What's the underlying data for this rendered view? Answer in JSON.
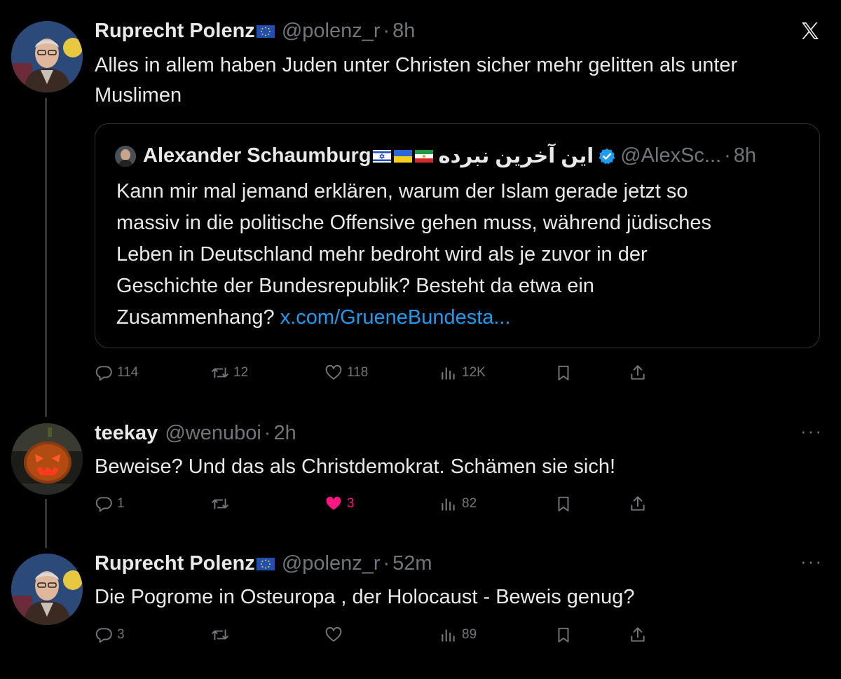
{
  "tweet1": {
    "author": "Ruprecht Polenz",
    "handle": "@polenz_r",
    "time": "8h",
    "text_line1": "Alles in allem haben Juden unter Christen sicher mehr gelitten als unter",
    "text_line2": "Muslimen",
    "quote": {
      "author": "Alexander Schaumburg",
      "author_rtl": "این آخرین نبرده",
      "handle": "@AlexSc...",
      "time": "8h",
      "lines": [
        "Kann mir mal jemand erklären, warum der Islam gerade jetzt so",
        "massiv in die politische Offensive gehen muss, während jüdisches",
        "Leben in Deutschland mehr bedroht wird als je zuvor in der",
        "Geschichte der Bundesrepublik? Besteht da etwa ein",
        "Zusammenhang?"
      ],
      "link": "x.com/GrueneBundesta..."
    },
    "stats": {
      "replies": "114",
      "retweets": "12",
      "likes": "118",
      "views": "12K"
    }
  },
  "tweet2": {
    "author": "teekay",
    "handle": "@wenuboi",
    "time": "2h",
    "text": "Beweise? Und das als Christdemokrat. Schämen sie sich!",
    "stats": {
      "replies": "1",
      "retweets": "",
      "likes": "3",
      "views": "82"
    }
  },
  "tweet3": {
    "author": "Ruprecht Polenz",
    "handle": "@polenz_r",
    "time": "52m",
    "text": "Die Pogrome in Osteuropa , der Holocaust - Beweis genug?",
    "stats": {
      "replies": "3",
      "retweets": "",
      "likes": "",
      "views": "89"
    }
  },
  "ui": {
    "dot": "·",
    "more": "···"
  },
  "colors": {
    "background": "#000000",
    "text": "#e7e9ea",
    "muted": "#71767b",
    "link": "#1d9bf0",
    "like": "#f91880"
  }
}
